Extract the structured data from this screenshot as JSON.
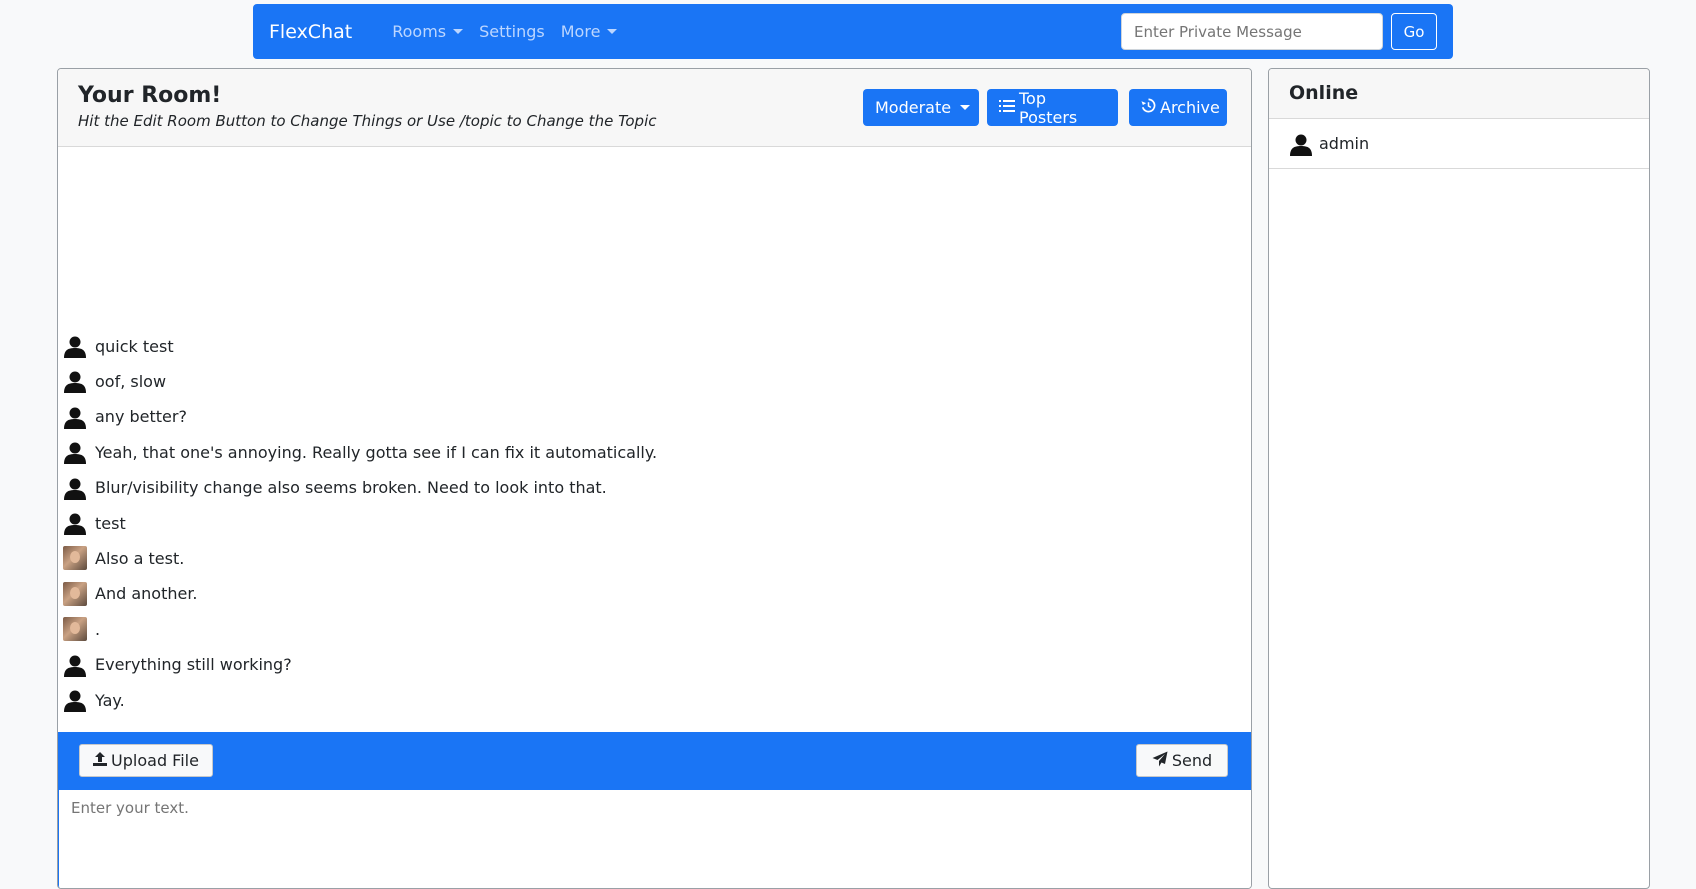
{
  "navbar": {
    "brand": "FlexChat",
    "links": [
      {
        "label": "Rooms",
        "dropdown": true
      },
      {
        "label": "Settings",
        "dropdown": false
      },
      {
        "label": "More",
        "dropdown": true
      }
    ],
    "pm_placeholder": "Enter Private Message",
    "go_label": "Go"
  },
  "room": {
    "title": "Your Room!",
    "topic": "Hit the Edit Room Button to Change Things or Use /topic to Change the Topic",
    "buttons": {
      "moderate": "Moderate",
      "top_posters": "Top Posters",
      "archive": "Archive"
    }
  },
  "messages": [
    {
      "avatar": "default-user-icon",
      "text": "quick test"
    },
    {
      "avatar": "default-user-icon",
      "text": "oof, slow"
    },
    {
      "avatar": "default-user-icon",
      "text": "any better?"
    },
    {
      "avatar": "default-user-icon",
      "text": "Yeah, that one's annoying. Really gotta see if I can fix it automatically."
    },
    {
      "avatar": "default-user-icon",
      "text": "Blur/visibility change also seems broken. Need to look into that."
    },
    {
      "avatar": "default-user-icon",
      "text": "test"
    },
    {
      "avatar": "photo-avatar",
      "text": "Also a test."
    },
    {
      "avatar": "photo-avatar",
      "text": "And another."
    },
    {
      "avatar": "photo-avatar",
      "text": "."
    },
    {
      "avatar": "default-user-icon",
      "text": "Everything still working?"
    },
    {
      "avatar": "default-user-icon",
      "text": "Yay."
    }
  ],
  "compose": {
    "upload_label": "Upload File",
    "send_label": "Send",
    "placeholder": "Enter your text."
  },
  "online": {
    "title": "Online",
    "users": [
      {
        "name": "admin",
        "avatar": "default-user-icon"
      }
    ]
  },
  "colors": {
    "primary": "#1a75f5",
    "nav_link": "#bcd6ff"
  }
}
